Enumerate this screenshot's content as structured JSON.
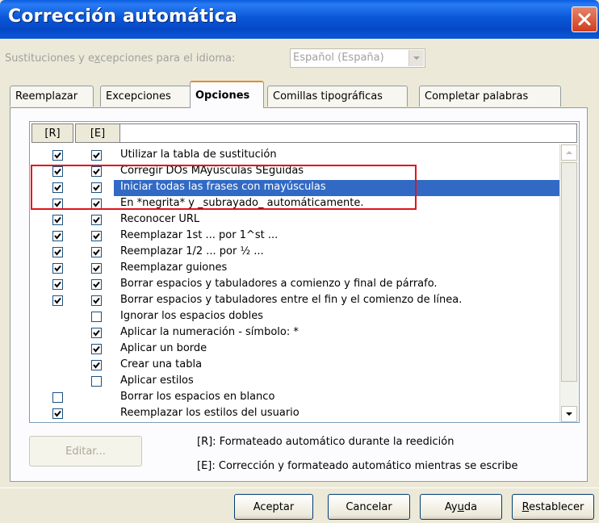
{
  "window": {
    "title": "Corrección automática"
  },
  "language": {
    "label": "Sustituciones y excepciones para el idioma:",
    "value": "Español (España)"
  },
  "tabs": [
    {
      "label": "Reemplazar",
      "active": false
    },
    {
      "label": "Excepciones",
      "active": false
    },
    {
      "label": "Opciones",
      "active": true
    },
    {
      "label": "Comillas tipográficas",
      "active": false
    },
    {
      "label": "Completar palabras",
      "active": false
    }
  ],
  "list": {
    "header_r": "[R]",
    "header_e": "[E]",
    "rows": [
      {
        "label": "Utilizar la tabla de sustitución",
        "r": true,
        "e": true,
        "selected": false
      },
      {
        "label": "Corregir DOs MAyúsculas SEguidas",
        "r": true,
        "e": true,
        "selected": false
      },
      {
        "label": "Iniciar todas las frases con mayúsculas",
        "r": true,
        "e": true,
        "selected": true
      },
      {
        "label": "En *negrita* y _subrayado_ automáticamente.",
        "r": true,
        "e": true,
        "selected": false
      },
      {
        "label": "Reconocer URL",
        "r": true,
        "e": true,
        "selected": false
      },
      {
        "label": "Reemplazar 1st ... por 1^st ...",
        "r": true,
        "e": true,
        "selected": false
      },
      {
        "label": "Reemplazar 1/2 ... por ½ ...",
        "r": true,
        "e": true,
        "selected": false
      },
      {
        "label": "Reemplazar guiones",
        "r": true,
        "e": true,
        "selected": false
      },
      {
        "label": "Borrar espacios y tabuladores a comienzo y final de párrafo.",
        "r": true,
        "e": true,
        "selected": false
      },
      {
        "label": "Borrar espacios y tabuladores entre el fin y el comienzo de línea.",
        "r": true,
        "e": true,
        "selected": false
      },
      {
        "label": "Ignorar los espacios dobles",
        "r": null,
        "e": false,
        "selected": false
      },
      {
        "label": "Aplicar la numeración - símbolo: *",
        "r": null,
        "e": true,
        "selected": false
      },
      {
        "label": "Aplicar un borde",
        "r": null,
        "e": true,
        "selected": false
      },
      {
        "label": "Crear una tabla",
        "r": null,
        "e": true,
        "selected": false
      },
      {
        "label": "Aplicar estilos",
        "r": null,
        "e": false,
        "selected": false
      },
      {
        "label": "Borrar los espacios en blanco",
        "r": false,
        "e": null,
        "selected": false
      },
      {
        "label": "Reemplazar los estilos del usuario",
        "r": true,
        "e": null,
        "selected": false
      }
    ]
  },
  "edit_button": "Editar...",
  "legend": {
    "r": "[R]: Formateado automático durante la reedición",
    "e": "[E]: Corrección y formateado automático mientras se escribe"
  },
  "buttons": {
    "ok": "Aceptar",
    "cancel": "Cancelar",
    "help": "Ayuda",
    "reset": "Restablecer"
  },
  "colors": {
    "titlebar": "#0a58d8",
    "selection": "#316ac5",
    "annotation": "#e0141e"
  }
}
